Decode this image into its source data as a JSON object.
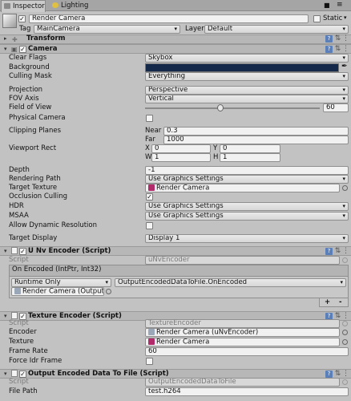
{
  "tabs": [
    {
      "label": "Inspector"
    },
    {
      "label": "Lighting"
    }
  ],
  "object": {
    "name": "Render Camera",
    "static_label": "Static",
    "tag_label": "Tag",
    "tag_value": "MainCamera",
    "layer_label": "Layer",
    "layer_value": "Default"
  },
  "transform": {
    "title": "Transform"
  },
  "camera": {
    "title": "Camera",
    "clear_flags": {
      "label": "Clear Flags",
      "value": "Skybox"
    },
    "background": {
      "label": "Background",
      "color": "#15294a"
    },
    "culling_mask": {
      "label": "Culling Mask",
      "value": "Everything"
    },
    "projection": {
      "label": "Projection",
      "value": "Perspective"
    },
    "fov_axis": {
      "label": "FOV Axis",
      "value": "Vertical"
    },
    "fov": {
      "label": "Field of View",
      "value": "60",
      "fraction": 0.43
    },
    "physical": {
      "label": "Physical Camera"
    },
    "clipping": {
      "label": "Clipping Planes",
      "near_label": "Near",
      "near": "0.3",
      "far_label": "Far",
      "far": "1000"
    },
    "viewport": {
      "label": "Viewport Rect",
      "x_label": "X",
      "x": "0",
      "y_label": "Y",
      "y": "0",
      "w_label": "W",
      "w": "1",
      "h_label": "H",
      "h": "1"
    },
    "depth": {
      "label": "Depth",
      "value": "-1"
    },
    "rendering_path": {
      "label": "Rendering Path",
      "value": "Use Graphics Settings"
    },
    "target_texture": {
      "label": "Target Texture",
      "value": "Render Camera"
    },
    "occlusion": {
      "label": "Occlusion Culling"
    },
    "hdr": {
      "label": "HDR",
      "value": "Use Graphics Settings"
    },
    "msaa": {
      "label": "MSAA",
      "value": "Use Graphics Settings"
    },
    "dynamic_res": {
      "label": "Allow Dynamic Resolution"
    },
    "target_display": {
      "label": "Target Display",
      "value": "Display 1"
    }
  },
  "nv_encoder": {
    "title": "U Nv Encoder (Script)",
    "script_label": "Script",
    "script_value": "uNvEncoder",
    "event_label": "On Encoded (IntPtr, Int32)",
    "runtime": "Runtime Only",
    "function": "OutputEncodedDataToFile.OnEncoded",
    "target": "Render Camera (OutputEnc",
    "plus": "+",
    "minus": "-"
  },
  "texture_encoder": {
    "title": "Texture Encoder (Script)",
    "script_label": "Script",
    "script_value": "TextureEncoder",
    "encoder_label": "Encoder",
    "encoder_value": "Render Camera (uNvEncoder)",
    "texture_label": "Texture",
    "texture_value": "Render Camera",
    "framerate_label": "Frame Rate",
    "framerate_value": "60",
    "force_label": "Force Idr Frame"
  },
  "output": {
    "title": "Output Encoded Data To File (Script)",
    "script_label": "Script",
    "script_value": "OutputEncodedDataToFile",
    "path_label": "File Path",
    "path_value": "test.h264"
  }
}
